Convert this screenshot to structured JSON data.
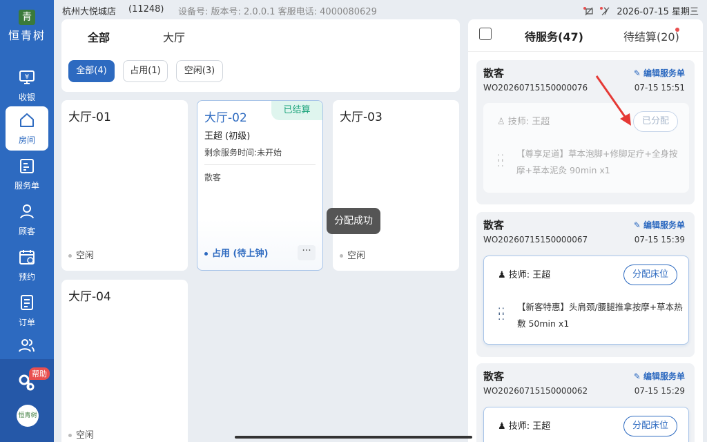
{
  "brand": {
    "name": "恒青树",
    "mark": "青",
    "mini": "恒青树"
  },
  "sidebar": {
    "items": [
      {
        "label": "收银",
        "icon": "cashier-icon"
      },
      {
        "label": "房间",
        "icon": "home-icon",
        "active": true
      },
      {
        "label": "服务单",
        "icon": "service-order-icon"
      },
      {
        "label": "顾客",
        "icon": "user-icon"
      },
      {
        "label": "预约",
        "icon": "calendar-icon"
      },
      {
        "label": "订单",
        "icon": "order-icon"
      },
      {
        "label": "",
        "icon": "users-icon"
      }
    ],
    "help_badge": "帮助"
  },
  "statusbar": {
    "store": "杭州大悦城店",
    "store_code": "(11248)",
    "meta": "设备号:  版本号:  2.0.0.1   客服电话:  4000080629",
    "datetime": "2026-07-15 星期三"
  },
  "filter": {
    "tab_all": "全部",
    "tab_hall": "大厅",
    "chips": [
      "全部(4)",
      "占用(1)",
      "空闲(3)"
    ]
  },
  "rooms": [
    {
      "name": "大厅-01",
      "status": "空闲"
    },
    {
      "name": "大厅-02",
      "badge": "已结算",
      "tech": "王超 (初级)",
      "remain": "剩余服务时间:未开始",
      "guest": "散客",
      "status": "占用 (待上钟)",
      "more": "···"
    },
    {
      "name": "大厅-03",
      "status": "空闲"
    },
    {
      "name": "大厅-04",
      "status": "空闲"
    }
  ],
  "toast": "分配成功",
  "right_panel": {
    "tab_waiting": "待服务(47)",
    "tab_settle": "待结算(20)",
    "orders": [
      {
        "customer": "散客",
        "edit": "编辑服务单",
        "order_no": "WO20260715150000076",
        "time": "07-15 15:51",
        "tech": "技师: 王超",
        "action": "已分配",
        "service": "【尊享足道】草本泡脚+修脚足疗+全身按摩+草本泥灸 90min x1"
      },
      {
        "customer": "散客",
        "edit": "编辑服务单",
        "order_no": "WO20260715150000067",
        "time": "07-15 15:39",
        "tech": "技师: 王超",
        "action": "分配床位",
        "service": "【新客特惠】头肩颈/腰腿推拿按摩+草本热敷 50min x1"
      },
      {
        "customer": "散客",
        "edit": "编辑服务单",
        "order_no": "WO20260715150000062",
        "time": "07-15 15:29",
        "tech": "技师: 王超",
        "action": "分配床位"
      }
    ]
  },
  "colors": {
    "primary": "#2d6ac0",
    "settled": "#1aa37a",
    "alert": "#e94f4f"
  }
}
